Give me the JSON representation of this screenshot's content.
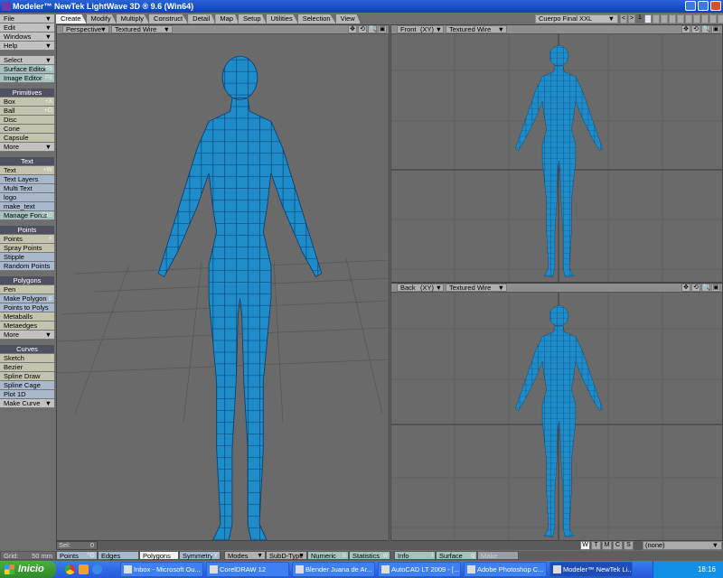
{
  "window": {
    "title": "Modeler™ NewTek LightWave 3D ® 9.6  (Win64)"
  },
  "tabs": [
    "Create",
    "Modify",
    "Multiply",
    "Construct",
    "Detail",
    "Map",
    "Setup",
    "Utilities",
    "Selection",
    "View"
  ],
  "active_tab": "Create",
  "object_selector": "Cuerpo Final XXL",
  "layer_number": "1",
  "sidebar": {
    "menus": [
      "File",
      "Edit",
      "Windows",
      "Help"
    ],
    "tools": [
      {
        "label": "Select",
        "style": "g",
        "arrow": true
      },
      {
        "label": "Surface Editor",
        "key": "F5",
        "style": "t"
      },
      {
        "label": "Image Editor",
        "key": "F6",
        "style": "t"
      }
    ],
    "groups": [
      {
        "title": "Primitives",
        "items": [
          {
            "label": "Box",
            "key": "+X",
            "style": "b"
          },
          {
            "label": "Ball",
            "key": "+O",
            "style": "b"
          },
          {
            "label": "Disc",
            "style": "b"
          },
          {
            "label": "Cone",
            "style": "b"
          },
          {
            "label": "Capsule",
            "style": "b"
          },
          {
            "label": "More",
            "style": "g",
            "arrow": true
          }
        ]
      },
      {
        "title": "Text",
        "items": [
          {
            "label": "Text",
            "key": "+W",
            "style": "b"
          },
          {
            "label": "Text Layers",
            "style": "u"
          },
          {
            "label": "Multi Text",
            "style": "u"
          },
          {
            "label": "logo",
            "style": "u"
          },
          {
            "label": "make_text",
            "style": "u"
          },
          {
            "label": "Manage Fonts",
            "key": "F10",
            "style": "t"
          }
        ]
      },
      {
        "title": "Points",
        "items": [
          {
            "label": "Points",
            "key": "+",
            "style": "b"
          },
          {
            "label": "Spray Points",
            "style": "b"
          },
          {
            "label": "Stipple",
            "style": "u"
          },
          {
            "label": "Random Points",
            "style": "u"
          }
        ]
      },
      {
        "title": "Polygons",
        "items": [
          {
            "label": "Pen",
            "style": "b"
          },
          {
            "label": "Make Polygon",
            "key": "p",
            "style": "u"
          },
          {
            "label": "Points to Polys",
            "style": "u"
          },
          {
            "label": "Metaballs",
            "style": "b"
          },
          {
            "label": "Metaedges",
            "style": "b"
          },
          {
            "label": "More",
            "style": "g",
            "arrow": true
          }
        ]
      },
      {
        "title": "Curves",
        "items": [
          {
            "label": "Sketch",
            "key": "'",
            "style": "b"
          },
          {
            "label": "Bezier",
            "style": "b"
          },
          {
            "label": "Spline Draw",
            "style": "b"
          },
          {
            "label": "Spline Cage",
            "style": "u"
          },
          {
            "label": "Plot 1D",
            "style": "u"
          },
          {
            "label": "Make Curve",
            "style": "g",
            "arrow": true
          }
        ]
      }
    ]
  },
  "viewports": {
    "perspective": {
      "view": "Perspective",
      "mode": "Textured Wire"
    },
    "front": {
      "view": "Front",
      "axis": "(XY)",
      "mode": "Textured Wire"
    },
    "back": {
      "view": "Back",
      "axis": "(XY)",
      "mode": "Textured Wire"
    }
  },
  "mesh_color": "#1e8cc8",
  "status": {
    "sel_label": "Sel:",
    "sel_value": "0",
    "grid_label": "Grid:",
    "grid_value": "50 mm",
    "wtmcs": [
      "W",
      "T",
      "M",
      "C",
      "S"
    ],
    "active_wtmcs": "W",
    "morph": "(none)"
  },
  "bottom_buttons": [
    {
      "label": "Points",
      "key": "^G",
      "bg": "#a9b9cd"
    },
    {
      "label": "Edges",
      "bg": "#a9b9cd"
    },
    {
      "label": "Polygons",
      "key": "^H",
      "bg": "#f4f4f4"
    },
    {
      "label": "Symmetry",
      "key": "+Y",
      "bg": "#a9b9cd"
    },
    {
      "label": "Modes",
      "arrow": true,
      "bg": "#b0b0b0"
    },
    {
      "label": "SubD-Type",
      "arrow": true,
      "bg": "#b0b0b0"
    },
    {
      "label": "Numeric",
      "key": "n",
      "bg": "#a6c2bf"
    },
    {
      "label": "Statistics",
      "key": "w",
      "bg": "#a6c2bf"
    },
    {
      "label": "Info",
      "key": "i",
      "bg": "#a6c2bf"
    },
    {
      "label": "Surface",
      "key": "q",
      "bg": "#a6c2bf"
    },
    {
      "label": "Make",
      "bg": "#9a9ea8",
      "disabled": true
    }
  ],
  "taskbar": {
    "start": "Inicio",
    "tasks": [
      "Inbox - Microsoft Ou...",
      "CorelDRAW 12",
      "Blender Juana de Ar...",
      "AutoCAD LT 2009 - [...",
      "Adobe Photoshop C...",
      "Modeler™ NewTek Li..."
    ],
    "active_task": 5,
    "clock": "18:16"
  }
}
